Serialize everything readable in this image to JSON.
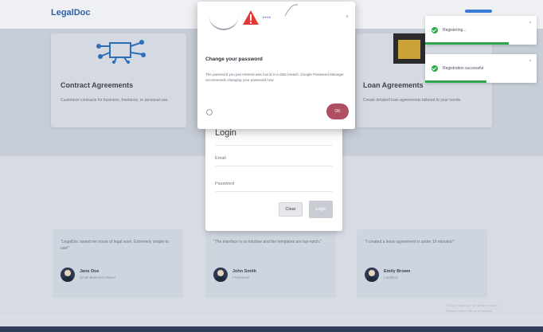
{
  "navbar": {
    "brand": "LegalDoc"
  },
  "cards": [
    {
      "title": "Contract Agreements",
      "desc": "Customize contracts for business, freelance, or personal use."
    },
    {
      "title": "Loan Agreements",
      "desc": "Create detailed loan agreements tailored to your needs."
    }
  ],
  "testimonials": [
    {
      "quote": "\"LegalDoc saved me hours of legal work. Extremely simple to use!\"",
      "name": "Jane Doe",
      "role": "Small Business Owner"
    },
    {
      "quote": "\"The interface is so intuitive and the templates are top-notch.\"",
      "name": "John Smith",
      "role": "Freelancer"
    },
    {
      "quote": "\"I created a lease agreement in under 10 minutes!\"",
      "name": "Emily Brown",
      "role": "Landlord"
    }
  ],
  "footer": {
    "line1": "© 2024 LegalDoc. All rights reserved.",
    "line2": "Privacy Policy | Terms of Service"
  },
  "login": {
    "title": "Login",
    "email_placeholder": "Email",
    "password_placeholder": "Password",
    "clear_label": "Clear",
    "login_label": "Login"
  },
  "dialog": {
    "title": "Change your password",
    "text": "The password you just entered was found in a data breach. Google Password Manager recommends changing your password now.",
    "ok_label": "OK",
    "close": "×",
    "dots": "••••"
  },
  "toasts": [
    {
      "text": "Registering...",
      "close": "×",
      "progress": 0.75
    },
    {
      "text": "Registration successful",
      "close": "×",
      "progress": 0.55
    }
  ],
  "colors": {
    "accent": "#2f5fa7",
    "success": "#2fa84f",
    "ok_button": "#b04f62",
    "warning": "#e53935"
  }
}
